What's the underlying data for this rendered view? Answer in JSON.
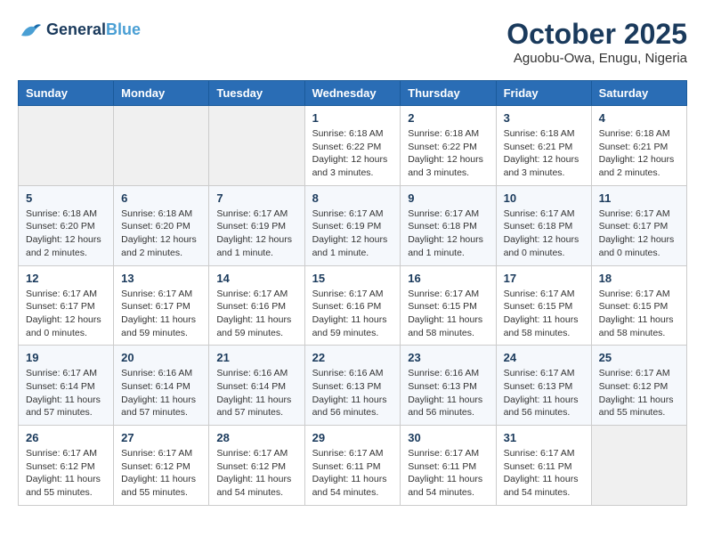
{
  "header": {
    "logo_line1": "General",
    "logo_line2": "Blue",
    "month": "October 2025",
    "location": "Aguobu-Owa, Enugu, Nigeria"
  },
  "weekdays": [
    "Sunday",
    "Monday",
    "Tuesday",
    "Wednesday",
    "Thursday",
    "Friday",
    "Saturday"
  ],
  "weeks": [
    [
      {
        "day": "",
        "info": ""
      },
      {
        "day": "",
        "info": ""
      },
      {
        "day": "",
        "info": ""
      },
      {
        "day": "1",
        "info": "Sunrise: 6:18 AM\nSunset: 6:22 PM\nDaylight: 12 hours\nand 3 minutes."
      },
      {
        "day": "2",
        "info": "Sunrise: 6:18 AM\nSunset: 6:22 PM\nDaylight: 12 hours\nand 3 minutes."
      },
      {
        "day": "3",
        "info": "Sunrise: 6:18 AM\nSunset: 6:21 PM\nDaylight: 12 hours\nand 3 minutes."
      },
      {
        "day": "4",
        "info": "Sunrise: 6:18 AM\nSunset: 6:21 PM\nDaylight: 12 hours\nand 2 minutes."
      }
    ],
    [
      {
        "day": "5",
        "info": "Sunrise: 6:18 AM\nSunset: 6:20 PM\nDaylight: 12 hours\nand 2 minutes."
      },
      {
        "day": "6",
        "info": "Sunrise: 6:18 AM\nSunset: 6:20 PM\nDaylight: 12 hours\nand 2 minutes."
      },
      {
        "day": "7",
        "info": "Sunrise: 6:17 AM\nSunset: 6:19 PM\nDaylight: 12 hours\nand 1 minute."
      },
      {
        "day": "8",
        "info": "Sunrise: 6:17 AM\nSunset: 6:19 PM\nDaylight: 12 hours\nand 1 minute."
      },
      {
        "day": "9",
        "info": "Sunrise: 6:17 AM\nSunset: 6:18 PM\nDaylight: 12 hours\nand 1 minute."
      },
      {
        "day": "10",
        "info": "Sunrise: 6:17 AM\nSunset: 6:18 PM\nDaylight: 12 hours\nand 0 minutes."
      },
      {
        "day": "11",
        "info": "Sunrise: 6:17 AM\nSunset: 6:17 PM\nDaylight: 12 hours\nand 0 minutes."
      }
    ],
    [
      {
        "day": "12",
        "info": "Sunrise: 6:17 AM\nSunset: 6:17 PM\nDaylight: 12 hours\nand 0 minutes."
      },
      {
        "day": "13",
        "info": "Sunrise: 6:17 AM\nSunset: 6:17 PM\nDaylight: 11 hours\nand 59 minutes."
      },
      {
        "day": "14",
        "info": "Sunrise: 6:17 AM\nSunset: 6:16 PM\nDaylight: 11 hours\nand 59 minutes."
      },
      {
        "day": "15",
        "info": "Sunrise: 6:17 AM\nSunset: 6:16 PM\nDaylight: 11 hours\nand 59 minutes."
      },
      {
        "day": "16",
        "info": "Sunrise: 6:17 AM\nSunset: 6:15 PM\nDaylight: 11 hours\nand 58 minutes."
      },
      {
        "day": "17",
        "info": "Sunrise: 6:17 AM\nSunset: 6:15 PM\nDaylight: 11 hours\nand 58 minutes."
      },
      {
        "day": "18",
        "info": "Sunrise: 6:17 AM\nSunset: 6:15 PM\nDaylight: 11 hours\nand 58 minutes."
      }
    ],
    [
      {
        "day": "19",
        "info": "Sunrise: 6:17 AM\nSunset: 6:14 PM\nDaylight: 11 hours\nand 57 minutes."
      },
      {
        "day": "20",
        "info": "Sunrise: 6:16 AM\nSunset: 6:14 PM\nDaylight: 11 hours\nand 57 minutes."
      },
      {
        "day": "21",
        "info": "Sunrise: 6:16 AM\nSunset: 6:14 PM\nDaylight: 11 hours\nand 57 minutes."
      },
      {
        "day": "22",
        "info": "Sunrise: 6:16 AM\nSunset: 6:13 PM\nDaylight: 11 hours\nand 56 minutes."
      },
      {
        "day": "23",
        "info": "Sunrise: 6:16 AM\nSunset: 6:13 PM\nDaylight: 11 hours\nand 56 minutes."
      },
      {
        "day": "24",
        "info": "Sunrise: 6:17 AM\nSunset: 6:13 PM\nDaylight: 11 hours\nand 56 minutes."
      },
      {
        "day": "25",
        "info": "Sunrise: 6:17 AM\nSunset: 6:12 PM\nDaylight: 11 hours\nand 55 minutes."
      }
    ],
    [
      {
        "day": "26",
        "info": "Sunrise: 6:17 AM\nSunset: 6:12 PM\nDaylight: 11 hours\nand 55 minutes."
      },
      {
        "day": "27",
        "info": "Sunrise: 6:17 AM\nSunset: 6:12 PM\nDaylight: 11 hours\nand 55 minutes."
      },
      {
        "day": "28",
        "info": "Sunrise: 6:17 AM\nSunset: 6:12 PM\nDaylight: 11 hours\nand 54 minutes."
      },
      {
        "day": "29",
        "info": "Sunrise: 6:17 AM\nSunset: 6:11 PM\nDaylight: 11 hours\nand 54 minutes."
      },
      {
        "day": "30",
        "info": "Sunrise: 6:17 AM\nSunset: 6:11 PM\nDaylight: 11 hours\nand 54 minutes."
      },
      {
        "day": "31",
        "info": "Sunrise: 6:17 AM\nSunset: 6:11 PM\nDaylight: 11 hours\nand 54 minutes."
      },
      {
        "day": "",
        "info": ""
      }
    ]
  ]
}
